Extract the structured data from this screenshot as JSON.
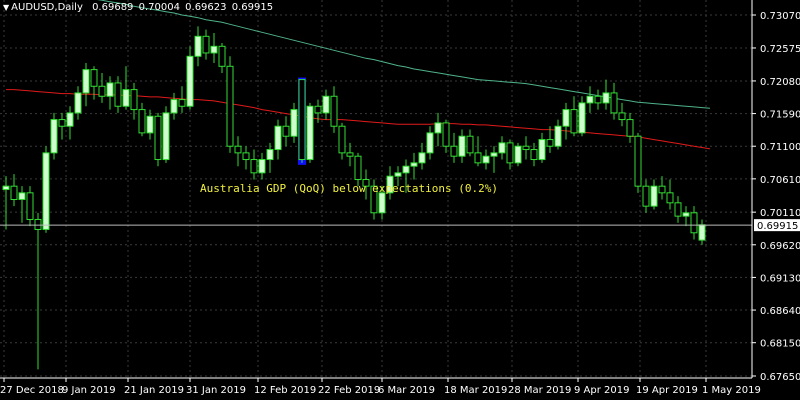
{
  "header": {
    "symbol": "AUDUSD,Daily",
    "open": "0.69689",
    "high": "0.70004",
    "low": "0.69623",
    "close": "0.69915"
  },
  "colors": {
    "background": "#000000",
    "grid": "#3a3a3a",
    "bull_candle": "#ccffcc",
    "bear_candle": "#000000",
    "wick": "#33dd33",
    "ma_fast": "#e11a1a",
    "ma_slow": "#4fb38a",
    "annotation": "#f0f040",
    "event_bar": "#1010ff",
    "axis_text": "#ffffff",
    "current_price_line": "#bbbbbb"
  },
  "chart_data": {
    "type": "candlestick",
    "title": "AUDUSD,Daily",
    "ylim": [
      0.6765,
      0.7307
    ],
    "y_ticks": [
      "0.73070",
      "0.72575",
      "0.72080",
      "0.71590",
      "0.71100",
      "0.70610",
      "0.70110",
      "0.69620",
      "0.69130",
      "0.68640",
      "0.68150",
      "0.67650"
    ],
    "x_ticks": [
      "27 Dec 2018",
      "9 Jan 2019",
      "21 Jan 2019",
      "31 Jan 2019",
      "12 Feb 2019",
      "22 Feb 2019",
      "6 Mar 2019",
      "18 Mar 2019",
      "28 Mar 2019",
      "9 Apr 2019",
      "19 Apr 2019",
      "1 May 2019"
    ],
    "current_price": "0.69915",
    "grid": true,
    "annotation": "Australia GDP (QoQ) below expectations (0.2%)",
    "event_index": 37,
    "candles": [
      {
        "o": 0.7045,
        "h": 0.7065,
        "l": 0.6985,
        "c": 0.705
      },
      {
        "o": 0.705,
        "h": 0.7068,
        "l": 0.702,
        "c": 0.703
      },
      {
        "o": 0.703,
        "h": 0.705,
        "l": 0.6995,
        "c": 0.704
      },
      {
        "o": 0.704,
        "h": 0.705,
        "l": 0.699,
        "c": 0.7
      },
      {
        "o": 0.7,
        "h": 0.701,
        "l": 0.6775,
        "c": 0.6985
      },
      {
        "o": 0.6985,
        "h": 0.711,
        "l": 0.698,
        "c": 0.71
      },
      {
        "o": 0.71,
        "h": 0.716,
        "l": 0.709,
        "c": 0.715
      },
      {
        "o": 0.715,
        "h": 0.716,
        "l": 0.712,
        "c": 0.714
      },
      {
        "o": 0.714,
        "h": 0.717,
        "l": 0.712,
        "c": 0.716
      },
      {
        "o": 0.716,
        "h": 0.72,
        "l": 0.715,
        "c": 0.719
      },
      {
        "o": 0.719,
        "h": 0.7235,
        "l": 0.717,
        "c": 0.7225
      },
      {
        "o": 0.7225,
        "h": 0.723,
        "l": 0.718,
        "c": 0.72
      },
      {
        "o": 0.72,
        "h": 0.722,
        "l": 0.7175,
        "c": 0.7185
      },
      {
        "o": 0.7185,
        "h": 0.7215,
        "l": 0.7165,
        "c": 0.7205
      },
      {
        "o": 0.7205,
        "h": 0.7215,
        "l": 0.716,
        "c": 0.717
      },
      {
        "o": 0.717,
        "h": 0.723,
        "l": 0.7165,
        "c": 0.7195
      },
      {
        "o": 0.7195,
        "h": 0.7205,
        "l": 0.715,
        "c": 0.7165
      },
      {
        "o": 0.7165,
        "h": 0.7175,
        "l": 0.7125,
        "c": 0.713
      },
      {
        "o": 0.713,
        "h": 0.7165,
        "l": 0.712,
        "c": 0.7155
      },
      {
        "o": 0.7155,
        "h": 0.716,
        "l": 0.708,
        "c": 0.709
      },
      {
        "o": 0.709,
        "h": 0.717,
        "l": 0.7085,
        "c": 0.716
      },
      {
        "o": 0.716,
        "h": 0.719,
        "l": 0.715,
        "c": 0.718
      },
      {
        "o": 0.718,
        "h": 0.72,
        "l": 0.716,
        "c": 0.717
      },
      {
        "o": 0.717,
        "h": 0.726,
        "l": 0.7165,
        "c": 0.7245
      },
      {
        "o": 0.7245,
        "h": 0.729,
        "l": 0.723,
        "c": 0.7275
      },
      {
        "o": 0.7275,
        "h": 0.7285,
        "l": 0.724,
        "c": 0.725
      },
      {
        "o": 0.725,
        "h": 0.728,
        "l": 0.7235,
        "c": 0.726
      },
      {
        "o": 0.726,
        "h": 0.7265,
        "l": 0.722,
        "c": 0.723
      },
      {
        "o": 0.723,
        "h": 0.7245,
        "l": 0.71,
        "c": 0.711
      },
      {
        "o": 0.711,
        "h": 0.7125,
        "l": 0.708,
        "c": 0.71
      },
      {
        "o": 0.71,
        "h": 0.711,
        "l": 0.7075,
        "c": 0.709
      },
      {
        "o": 0.709,
        "h": 0.7105,
        "l": 0.706,
        "c": 0.707
      },
      {
        "o": 0.707,
        "h": 0.71,
        "l": 0.706,
        "c": 0.709
      },
      {
        "o": 0.709,
        "h": 0.7115,
        "l": 0.707,
        "c": 0.7105
      },
      {
        "o": 0.7105,
        "h": 0.715,
        "l": 0.709,
        "c": 0.714
      },
      {
        "o": 0.714,
        "h": 0.7155,
        "l": 0.711,
        "c": 0.7125
      },
      {
        "o": 0.7125,
        "h": 0.7175,
        "l": 0.7115,
        "c": 0.7165
      },
      {
        "o": 0.721,
        "h": 0.721,
        "l": 0.7085,
        "c": 0.709
      },
      {
        "o": 0.709,
        "h": 0.7175,
        "l": 0.7085,
        "c": 0.717
      },
      {
        "o": 0.717,
        "h": 0.718,
        "l": 0.7145,
        "c": 0.716
      },
      {
        "o": 0.716,
        "h": 0.7195,
        "l": 0.715,
        "c": 0.7185
      },
      {
        "o": 0.7185,
        "h": 0.72,
        "l": 0.713,
        "c": 0.714
      },
      {
        "o": 0.714,
        "h": 0.7145,
        "l": 0.709,
        "c": 0.71
      },
      {
        "o": 0.71,
        "h": 0.7115,
        "l": 0.708,
        "c": 0.7095
      },
      {
        "o": 0.7095,
        "h": 0.71,
        "l": 0.705,
        "c": 0.706
      },
      {
        "o": 0.706,
        "h": 0.7075,
        "l": 0.703,
        "c": 0.705
      },
      {
        "o": 0.705,
        "h": 0.706,
        "l": 0.7,
        "c": 0.701
      },
      {
        "o": 0.701,
        "h": 0.705,
        "l": 0.7,
        "c": 0.704
      },
      {
        "o": 0.704,
        "h": 0.708,
        "l": 0.703,
        "c": 0.7065
      },
      {
        "o": 0.7065,
        "h": 0.708,
        "l": 0.705,
        "c": 0.707
      },
      {
        "o": 0.707,
        "h": 0.709,
        "l": 0.704,
        "c": 0.708
      },
      {
        "o": 0.708,
        "h": 0.71,
        "l": 0.706,
        "c": 0.7085
      },
      {
        "o": 0.7085,
        "h": 0.7115,
        "l": 0.7075,
        "c": 0.71
      },
      {
        "o": 0.71,
        "h": 0.714,
        "l": 0.709,
        "c": 0.713
      },
      {
        "o": 0.713,
        "h": 0.716,
        "l": 0.711,
        "c": 0.7145
      },
      {
        "o": 0.7145,
        "h": 0.715,
        "l": 0.71,
        "c": 0.711
      },
      {
        "o": 0.711,
        "h": 0.713,
        "l": 0.7085,
        "c": 0.7095
      },
      {
        "o": 0.7095,
        "h": 0.7135,
        "l": 0.7085,
        "c": 0.7125
      },
      {
        "o": 0.7125,
        "h": 0.7135,
        "l": 0.7095,
        "c": 0.71
      },
      {
        "o": 0.71,
        "h": 0.7125,
        "l": 0.708,
        "c": 0.7085
      },
      {
        "o": 0.7085,
        "h": 0.7105,
        "l": 0.7075,
        "c": 0.7095
      },
      {
        "o": 0.7095,
        "h": 0.711,
        "l": 0.707,
        "c": 0.71
      },
      {
        "o": 0.71,
        "h": 0.7125,
        "l": 0.709,
        "c": 0.7115
      },
      {
        "o": 0.7115,
        "h": 0.712,
        "l": 0.7075,
        "c": 0.7085
      },
      {
        "o": 0.7085,
        "h": 0.7115,
        "l": 0.708,
        "c": 0.711
      },
      {
        "o": 0.711,
        "h": 0.7125,
        "l": 0.709,
        "c": 0.7105
      },
      {
        "o": 0.7105,
        "h": 0.7115,
        "l": 0.708,
        "c": 0.709
      },
      {
        "o": 0.709,
        "h": 0.713,
        "l": 0.7085,
        "c": 0.712
      },
      {
        "o": 0.712,
        "h": 0.714,
        "l": 0.71,
        "c": 0.711
      },
      {
        "o": 0.711,
        "h": 0.715,
        "l": 0.7105,
        "c": 0.714
      },
      {
        "o": 0.714,
        "h": 0.7175,
        "l": 0.712,
        "c": 0.7165
      },
      {
        "o": 0.7165,
        "h": 0.7185,
        "l": 0.7125,
        "c": 0.713
      },
      {
        "o": 0.713,
        "h": 0.7185,
        "l": 0.7125,
        "c": 0.7175
      },
      {
        "o": 0.7175,
        "h": 0.72,
        "l": 0.716,
        "c": 0.7185
      },
      {
        "o": 0.7185,
        "h": 0.7195,
        "l": 0.7165,
        "c": 0.7175
      },
      {
        "o": 0.7175,
        "h": 0.721,
        "l": 0.7165,
        "c": 0.719
      },
      {
        "o": 0.719,
        "h": 0.7205,
        "l": 0.715,
        "c": 0.716
      },
      {
        "o": 0.716,
        "h": 0.7175,
        "l": 0.714,
        "c": 0.715
      },
      {
        "o": 0.715,
        "h": 0.716,
        "l": 0.7115,
        "c": 0.7125
      },
      {
        "o": 0.7125,
        "h": 0.713,
        "l": 0.704,
        "c": 0.705
      },
      {
        "o": 0.705,
        "h": 0.706,
        "l": 0.701,
        "c": 0.702
      },
      {
        "o": 0.702,
        "h": 0.706,
        "l": 0.7015,
        "c": 0.705
      },
      {
        "o": 0.705,
        "h": 0.7065,
        "l": 0.703,
        "c": 0.704
      },
      {
        "o": 0.704,
        "h": 0.706,
        "l": 0.7015,
        "c": 0.7025
      },
      {
        "o": 0.7025,
        "h": 0.7035,
        "l": 0.6995,
        "c": 0.7005
      },
      {
        "o": 0.7005,
        "h": 0.702,
        "l": 0.699,
        "c": 0.701
      },
      {
        "o": 0.701,
        "h": 0.702,
        "l": 0.697,
        "c": 0.698
      },
      {
        "o": 0.6969,
        "h": 0.7,
        "l": 0.6962,
        "c": 0.6992
      }
    ],
    "ma_fast": [
      0.7195,
      0.7195,
      0.7194,
      0.7193,
      0.7192,
      0.7191,
      0.719,
      0.7189,
      0.7189,
      0.7188,
      0.7188,
      0.7188,
      0.7187,
      0.7187,
      0.7187,
      0.7186,
      0.7186,
      0.7185,
      0.7184,
      0.7184,
      0.7183,
      0.7182,
      0.7181,
      0.718,
      0.718,
      0.7179,
      0.7178,
      0.7176,
      0.7174,
      0.7172,
      0.717,
      0.7168,
      0.7165,
      0.7163,
      0.7161,
      0.7159,
      0.7157,
      0.7155,
      0.7153,
      0.7151,
      0.715,
      0.715,
      0.715,
      0.7149,
      0.7148,
      0.7147,
      0.7146,
      0.7145,
      0.7144,
      0.7143,
      0.7143,
      0.7143,
      0.7143,
      0.7143,
      0.7144,
      0.7144,
      0.7144,
      0.7143,
      0.7143,
      0.7142,
      0.7142,
      0.7141,
      0.714,
      0.7139,
      0.7138,
      0.7137,
      0.7136,
      0.7135,
      0.7135,
      0.7134,
      0.7133,
      0.7132,
      0.7131,
      0.713,
      0.7129,
      0.7128,
      0.7127,
      0.7126,
      0.7125,
      0.7124,
      0.7122,
      0.712,
      0.7118,
      0.7116,
      0.7114,
      0.7112,
      0.711,
      0.7108,
      0.7106
    ],
    "ma_slow": [
      0.7355,
      0.7353,
      0.7351,
      0.7349,
      0.7346,
      0.7344,
      0.7342,
      0.734,
      0.7337,
      0.7335,
      0.7333,
      0.7331,
      0.7329,
      0.7327,
      0.7325,
      0.7323,
      0.732,
      0.7318,
      0.7316,
      0.7314,
      0.7312,
      0.731,
      0.7307,
      0.7305,
      0.7303,
      0.73,
      0.7298,
      0.7296,
      0.7293,
      0.729,
      0.7287,
      0.7284,
      0.7281,
      0.7278,
      0.7275,
      0.7272,
      0.7269,
      0.7266,
      0.7263,
      0.726,
      0.7257,
      0.7254,
      0.7251,
      0.7248,
      0.7245,
      0.7242,
      0.724,
      0.7237,
      0.7234,
      0.7231,
      0.7229,
      0.7226,
      0.7224,
      0.7222,
      0.722,
      0.7218,
      0.7216,
      0.7214,
      0.7212,
      0.721,
      0.7209,
      0.7208,
      0.7207,
      0.7206,
      0.7205,
      0.7204,
      0.7202,
      0.72,
      0.7198,
      0.7196,
      0.7194,
      0.7192,
      0.719,
      0.7188,
      0.7186,
      0.7184,
      0.7182,
      0.718,
      0.7178,
      0.7176,
      0.7175,
      0.7174,
      0.7173,
      0.7172,
      0.7171,
      0.717,
      0.7169,
      0.7168,
      0.7167
    ]
  }
}
